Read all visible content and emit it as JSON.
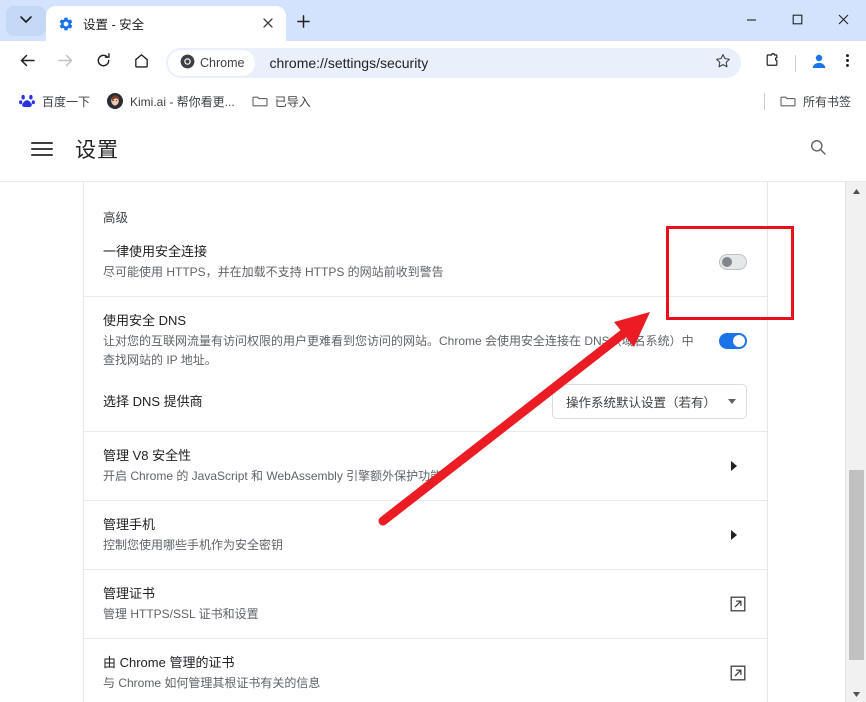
{
  "window": {
    "tab": {
      "title": "设置 - 安全",
      "favicon": "settings-gear-icon",
      "close": "close-icon"
    },
    "tab_list_icon": "chevron-down-icon",
    "new_tab_icon": "plus-icon",
    "controls": {
      "minimize": "minimize-icon",
      "maximize": "maximize-icon",
      "close": "close-icon"
    }
  },
  "toolbar": {
    "back_icon": "back-arrow-icon",
    "forward_icon": "forward-arrow-icon",
    "reload_icon": "reload-icon",
    "home_icon": "home-icon",
    "chrome_chip_label": "Chrome",
    "url": "chrome://settings/security",
    "bookmark_icon": "star-icon",
    "extensions_icon": "puzzle-piece-icon",
    "profile_icon": "profile-avatar-icon",
    "menu_icon": "three-dot-menu-icon"
  },
  "bookmarks": [
    {
      "label": "百度一下",
      "icon": "baidu-favicon"
    },
    {
      "label": "Kimi.ai - 帮你看更...",
      "icon": "kimi-favicon"
    },
    {
      "label": "已导入",
      "icon": "folder-icon"
    }
  ],
  "bookmarks_right": {
    "label": "所有书签",
    "icon": "folder-icon"
  },
  "settings": {
    "menu_icon": "hamburger-menu-icon",
    "title": "设置",
    "search_icon": "search-icon"
  },
  "page": {
    "section_label": "高级",
    "rows": [
      {
        "title": "一律使用安全连接",
        "sub": "尽可能使用 HTTPS，并在加载不支持 HTTPS 的网站前收到警告",
        "control": "toggle-off"
      },
      {
        "title": "使用安全 DNS",
        "sub": "让对您的互联网流量有访问权限的用户更难看到您访问的网站。Chrome 会使用安全连接在 DNS（域名系统）中查找网站的 IP 地址。",
        "control": "toggle-on"
      },
      {
        "title": "选择 DNS 提供商",
        "sub": "",
        "control": "dropdown",
        "dropdown_value": "操作系统默认设置（若有）"
      },
      {
        "title": "管理 V8 安全性",
        "sub": "开启 Chrome 的 JavaScript 和 WebAssembly 引擎额外保护功能",
        "control": "chevron-right"
      },
      {
        "title": "管理手机",
        "sub": "控制您使用哪些手机作为安全密钥",
        "control": "chevron-right"
      },
      {
        "title": "管理证书",
        "sub": "管理 HTTPS/SSL 证书和设置",
        "control": "external-link"
      },
      {
        "title": "由 Chrome 管理的证书",
        "sub": "与 Chrome 如何管理其根证书有关的信息",
        "control": "external-link"
      }
    ]
  },
  "annotations": {
    "highlight_color": "#e8101a",
    "arrow_color": "#ec1c24",
    "highlight_target": "一律使用安全连接 toggle"
  },
  "scrollbar": {
    "up_icon": "scroll-up-arrow-icon",
    "down_icon": "scroll-down-arrow-icon"
  }
}
